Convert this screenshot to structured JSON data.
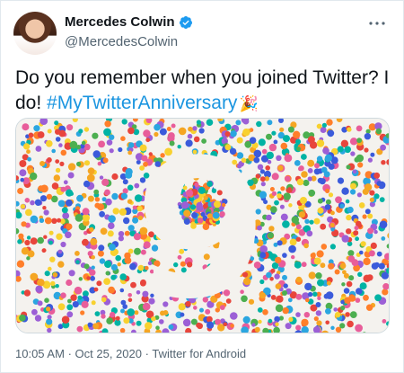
{
  "tweet": {
    "author_name": "Mercedes Colwin",
    "author_handle": "@MercedesColwin",
    "text_prefix": "Do you remember when you joined Twitter? I do!",
    "hashtag": "#MyTwitterAnniversary",
    "emoji": "🎉",
    "media": {
      "numeral": "9",
      "confetti_colors": [
        "#e8453c",
        "#f5a623",
        "#f8d12f",
        "#4caf50",
        "#2ba6e0",
        "#3b5bdb",
        "#9c5fd6",
        "#e85d9a",
        "#ff7f2a",
        "#00b3a4"
      ]
    },
    "time": "10:05 AM",
    "separator": "·",
    "date": "Oct 25, 2020",
    "source": "Twitter for Android"
  },
  "colors": {
    "hashtag": "#1b95e0",
    "verified": "#1d9bf0",
    "meta": "#536471"
  },
  "icons": {
    "verified": "verified-badge-icon",
    "more": "more-dots-icon"
  }
}
